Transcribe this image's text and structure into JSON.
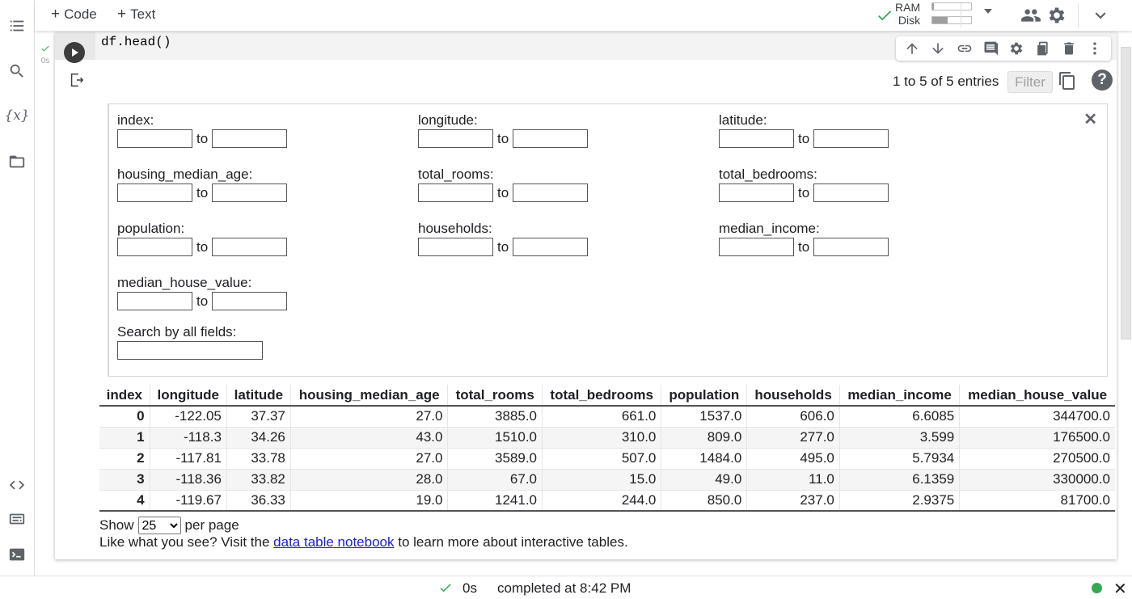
{
  "toolbar": {
    "add_code_label": "Code",
    "add_text_label": "Text",
    "ram_label": "RAM",
    "disk_label": "Disk",
    "ram_usage_fraction": 0.05,
    "disk_usage_fraction": 0.4
  },
  "cell": {
    "exec_status": "0s",
    "code": "df.head()"
  },
  "output": {
    "entries_text": "1 to 5 of 5 entries",
    "filter_label": "Filter",
    "help_label": "?",
    "close_label": "✕",
    "filters": [
      {
        "label": "index:",
        "to": "to"
      },
      {
        "label": "longitude:",
        "to": "to"
      },
      {
        "label": "latitude:",
        "to": "to"
      },
      {
        "label": "housing_median_age:",
        "to": "to"
      },
      {
        "label": "total_rooms:",
        "to": "to"
      },
      {
        "label": "total_bedrooms:",
        "to": "to"
      },
      {
        "label": "population:",
        "to": "to"
      },
      {
        "label": "households:",
        "to": "to"
      },
      {
        "label": "median_income:",
        "to": "to"
      },
      {
        "label": "median_house_value:",
        "to": "to"
      }
    ],
    "search_label": "Search by all fields:",
    "search_value": "",
    "table": {
      "columns": [
        "index",
        "longitude",
        "latitude",
        "housing_median_age",
        "total_rooms",
        "total_bedrooms",
        "population",
        "households",
        "median_income",
        "median_house_value"
      ],
      "rows": [
        [
          "0",
          "-122.05",
          "37.37",
          "27.0",
          "3885.0",
          "661.0",
          "1537.0",
          "606.0",
          "6.6085",
          "344700.0"
        ],
        [
          "1",
          "-118.3",
          "34.26",
          "43.0",
          "1510.0",
          "310.0",
          "809.0",
          "277.0",
          "3.599",
          "176500.0"
        ],
        [
          "2",
          "-117.81",
          "33.78",
          "27.0",
          "3589.0",
          "507.0",
          "1484.0",
          "495.0",
          "5.7934",
          "270500.0"
        ],
        [
          "3",
          "-118.36",
          "33.82",
          "28.0",
          "67.0",
          "15.0",
          "49.0",
          "11.0",
          "6.1359",
          "330000.0"
        ],
        [
          "4",
          "-119.67",
          "36.33",
          "19.0",
          "1241.0",
          "244.0",
          "850.0",
          "237.0",
          "2.9375",
          "81700.0"
        ]
      ]
    },
    "show_label": "Show",
    "per_page_value": "25",
    "per_page_label": "per page",
    "promo_before": "Like what you see? Visit the ",
    "promo_link": "data table notebook",
    "promo_after": " to learn more about interactive tables."
  },
  "statusbar": {
    "time": "0s",
    "text": "completed at 8:42 PM",
    "close_label": "✕",
    "dot_color": "#34a853"
  },
  "colors": {
    "success_green": "#34a853",
    "link_blue": "#1a1aee"
  }
}
